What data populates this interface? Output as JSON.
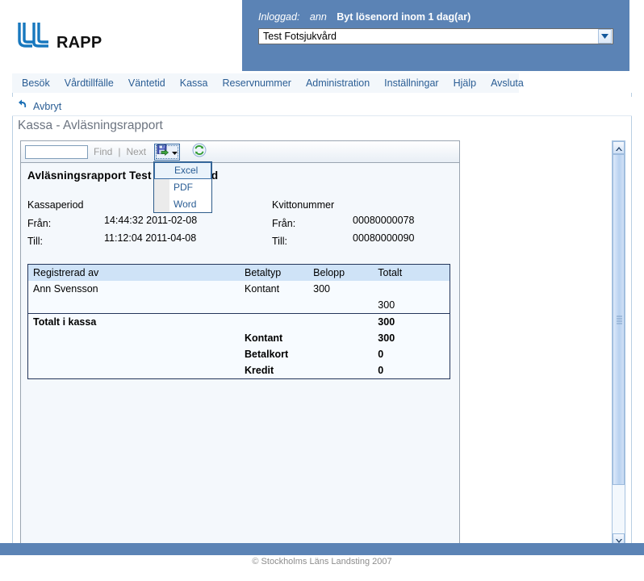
{
  "brand": {
    "logo_icon": "jll-logo-icon",
    "name": "RAPP"
  },
  "header": {
    "login_label": "Inloggad:",
    "login_user": "ann",
    "password_warning": "Byt lösenord inom 1 dag(ar)",
    "unit_select_value": "Test Fotsjukvård",
    "unit_select_icon": "chevron-down-icon",
    "blue_panel_color": "#5b83b5"
  },
  "menubar": {
    "items": [
      {
        "label": "Besök"
      },
      {
        "label": "Vårdtillfälle"
      },
      {
        "label": "Väntetid"
      },
      {
        "label": "Kassa"
      },
      {
        "label": "Reservnummer"
      },
      {
        "label": "Administration"
      },
      {
        "label": "Inställningar"
      },
      {
        "label": "Hjälp"
      },
      {
        "label": "Avsluta"
      }
    ]
  },
  "actionbar": {
    "cancel_label": "Avbryt",
    "cancel_icon": "undo-arrow-icon"
  },
  "page": {
    "title": "Kassa - Avläsningsrapport"
  },
  "report_toolbar": {
    "find_value": "",
    "find_placeholder": "",
    "find_label": "Find",
    "next_label": "Next",
    "export_icon": "save-export-icon",
    "export_caret_icon": "caret-down-icon",
    "refresh_icon": "refresh-icon"
  },
  "export_menu": {
    "items": [
      {
        "label": "Excel",
        "selected": true
      },
      {
        "label": "PDF",
        "selected": false
      },
      {
        "label": "Word",
        "selected": false
      }
    ]
  },
  "report": {
    "title": "Avläsningsrapport  Test Fotsjukvård",
    "period": {
      "heading": "Kassaperiod",
      "from_label": "Från:",
      "from_value": "14:44:32 2011-02-08",
      "to_label": "Till:",
      "to_value": "11:12:04 2011-04-08"
    },
    "receipt": {
      "heading": "Kvittonummer",
      "from_label": "Från:",
      "from_value": "00080000078",
      "to_label": "Till:",
      "to_value": "00080000090"
    },
    "table": {
      "columns": [
        "Registrerad av",
        "Betaltyp",
        "Belopp",
        "Totalt"
      ],
      "rows": [
        {
          "name": "Ann Svensson",
          "type": "Kontant",
          "amount": "300",
          "total": "",
          "bold": false,
          "separator": false
        },
        {
          "name": "",
          "type": "",
          "amount": "",
          "total": "300",
          "bold": false,
          "separator": false
        },
        {
          "name": "Totalt i kassa",
          "type": "",
          "amount": "",
          "total": "300",
          "bold": true,
          "separator": true
        },
        {
          "name": "",
          "type": "Kontant",
          "amount": "",
          "total": "300",
          "bold": true,
          "separator": false
        },
        {
          "name": "",
          "type": "Betalkort",
          "amount": "",
          "total": "0",
          "bold": true,
          "separator": false
        },
        {
          "name": "",
          "type": "Kredit",
          "amount": "",
          "total": "0",
          "bold": true,
          "separator": false
        }
      ]
    }
  },
  "scrollbar": {
    "up_icon": "chevron-up-icon",
    "down_icon": "chevron-down-icon"
  },
  "footer": {
    "text": "© Stockholms Läns Landsting 2007"
  }
}
